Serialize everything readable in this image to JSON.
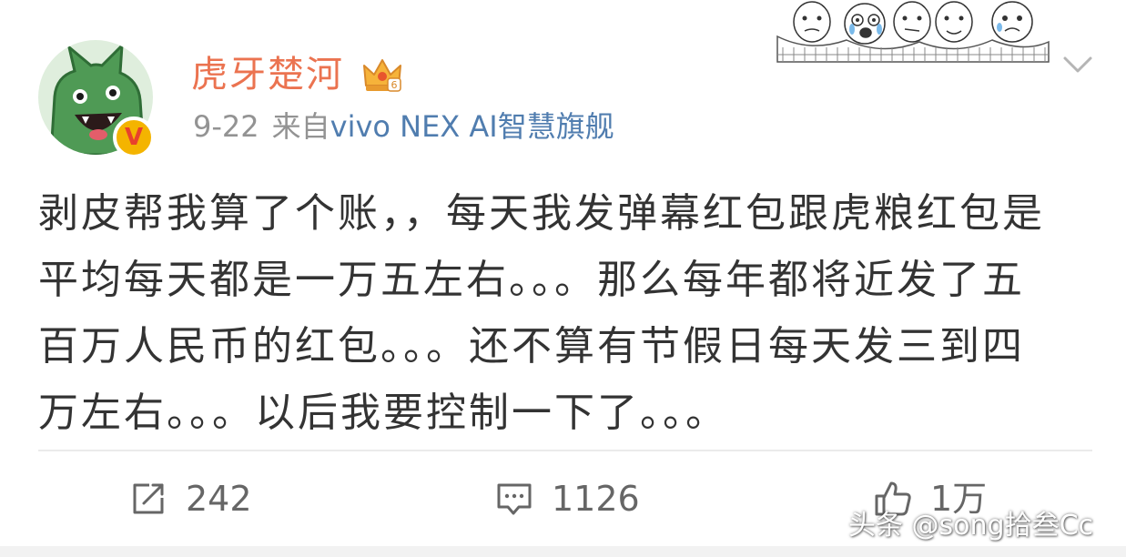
{
  "header": {
    "username": "虎牙楚河",
    "date": "9-22",
    "source_prefix": "来自",
    "device": "vivo NEX AI智慧旗舰",
    "avatar_badge": "V",
    "crown_level": "6"
  },
  "post": {
    "lines": [
      "剥皮帮我算了个账，，每天我发弹幕红包跟虎粮红包是",
      "平均每天都是一万五左右。。。那么每年都将近发了五",
      "百万人民币的红包。。。还不算有节假日每天发三到四",
      "万左右。。。以后我要控制一下了。。。"
    ]
  },
  "actions": {
    "repost_count": "242",
    "comment_count": "1126",
    "like_count": "1万"
  },
  "watermark": "头条 @song拾叁Cc",
  "colors": {
    "username": "#eb7350",
    "device_link": "#507daf",
    "meta": "#939393",
    "text": "#333333"
  },
  "icons": [
    "avatar-icon",
    "verified-badge-icon",
    "crown-icon",
    "sticker-decoration",
    "chevron-down-icon",
    "repost-icon",
    "comment-icon",
    "like-icon"
  ]
}
